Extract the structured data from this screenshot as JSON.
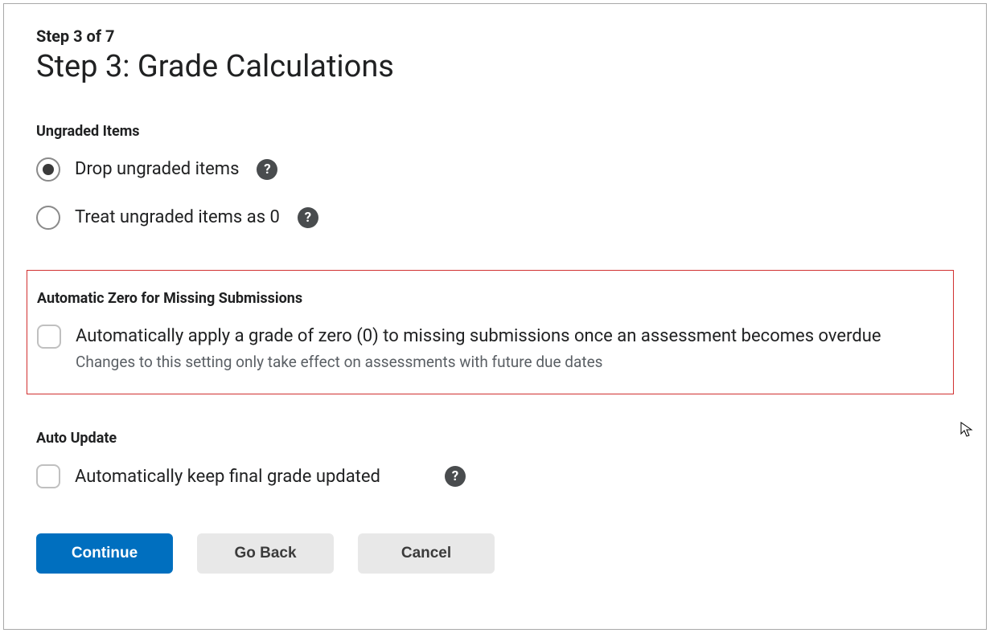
{
  "stepIndicator": "Step 3 of 7",
  "pageTitle": "Step 3: Grade Calculations",
  "ungraded": {
    "heading": "Ungraded Items",
    "options": [
      {
        "label": "Drop ungraded items",
        "selected": true
      },
      {
        "label": "Treat ungraded items as 0",
        "selected": false
      }
    ]
  },
  "autoZero": {
    "heading": "Automatic Zero for Missing Submissions",
    "label": "Automatically apply a grade of zero (0) to missing submissions once an assessment becomes overdue",
    "hint": "Changes to this setting only take effect on assessments with future due dates",
    "checked": false
  },
  "autoUpdate": {
    "heading": "Auto Update",
    "label": "Automatically keep final grade updated",
    "checked": false
  },
  "buttons": {
    "continue": "Continue",
    "goBack": "Go Back",
    "cancel": "Cancel"
  },
  "helpGlyph": "?"
}
